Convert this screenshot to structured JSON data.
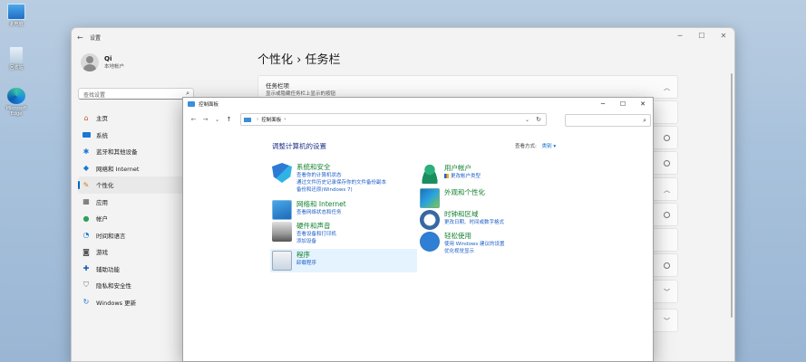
{
  "colors": {
    "accent": "#0067c0",
    "cp_heading": "#1e3287",
    "cp_category": "#13812e",
    "cp_link": "#1d5ec9"
  },
  "desktop": [
    {
      "label": "此电脑",
      "icon": "computer-icon"
    },
    {
      "label": "回收站",
      "icon": "recycle-bin-icon"
    },
    {
      "label": "Microsoft Edge",
      "icon": "edge-icon"
    }
  ],
  "settings": {
    "title": "设置",
    "user": {
      "name": "Qi",
      "account": "本地帐户"
    },
    "search_placeholder": "查找设置",
    "nav": [
      {
        "label": "主页",
        "icon": "home-icon"
      },
      {
        "label": "系统",
        "icon": "monitor-icon"
      },
      {
        "label": "蓝牙和其他设备",
        "icon": "bluetooth-icon"
      },
      {
        "label": "网络和 Internet",
        "icon": "wifi-icon"
      },
      {
        "label": "个性化",
        "icon": "brush-icon"
      },
      {
        "label": "应用",
        "icon": "apps-icon"
      },
      {
        "label": "帐户",
        "icon": "account-icon"
      },
      {
        "label": "时间和语言",
        "icon": "globe-clock-icon"
      },
      {
        "label": "游戏",
        "icon": "gamepad-icon"
      },
      {
        "label": "辅助功能",
        "icon": "accessibility-icon"
      },
      {
        "label": "隐私和安全性",
        "icon": "shield-icon"
      },
      {
        "label": "Windows 更新",
        "icon": "update-icon"
      }
    ],
    "breadcrumb": {
      "parent": "个性化",
      "sep": "›",
      "current": "任务栏"
    },
    "taskbar_items": {
      "title": "任务栏项",
      "subtitle": "显示或隐藏任务栏上显示的按钮"
    }
  },
  "control_panel": {
    "title": "控制面板",
    "address": "控制面板",
    "heading": "调整计算机的设置",
    "view_by_label": "查看方式:",
    "view_by_value": "类别",
    "categories_left": [
      {
        "title": "系统和安全",
        "links": [
          "查看你的计算机状态",
          "通过文件历史记录保存你的文件备份副本",
          "备份和还原(Windows 7)"
        ],
        "icon": "shield-system-icon"
      },
      {
        "title": "网络和 Internet",
        "links": [
          "查看网络状态和任务"
        ],
        "icon": "network-icon"
      },
      {
        "title": "硬件和声音",
        "links": [
          "查看设备和打印机",
          "添加设备"
        ],
        "icon": "printer-icon"
      },
      {
        "title": "程序",
        "links": [
          "卸载程序"
        ],
        "icon": "programs-icon"
      }
    ],
    "categories_right": [
      {
        "title": "用户帐户",
        "links": [
          "更改帐户类型"
        ],
        "icon": "user-accounts-icon"
      },
      {
        "title": "外观和个性化",
        "links": [],
        "icon": "appearance-icon"
      },
      {
        "title": "时钟和区域",
        "links": [
          "更改日期、时间或数字格式"
        ],
        "icon": "clock-region-icon"
      },
      {
        "title": "轻松使用",
        "links": [
          "使用 Windows 建议的设置",
          "优化视觉显示"
        ],
        "icon": "ease-of-access-icon"
      }
    ]
  }
}
